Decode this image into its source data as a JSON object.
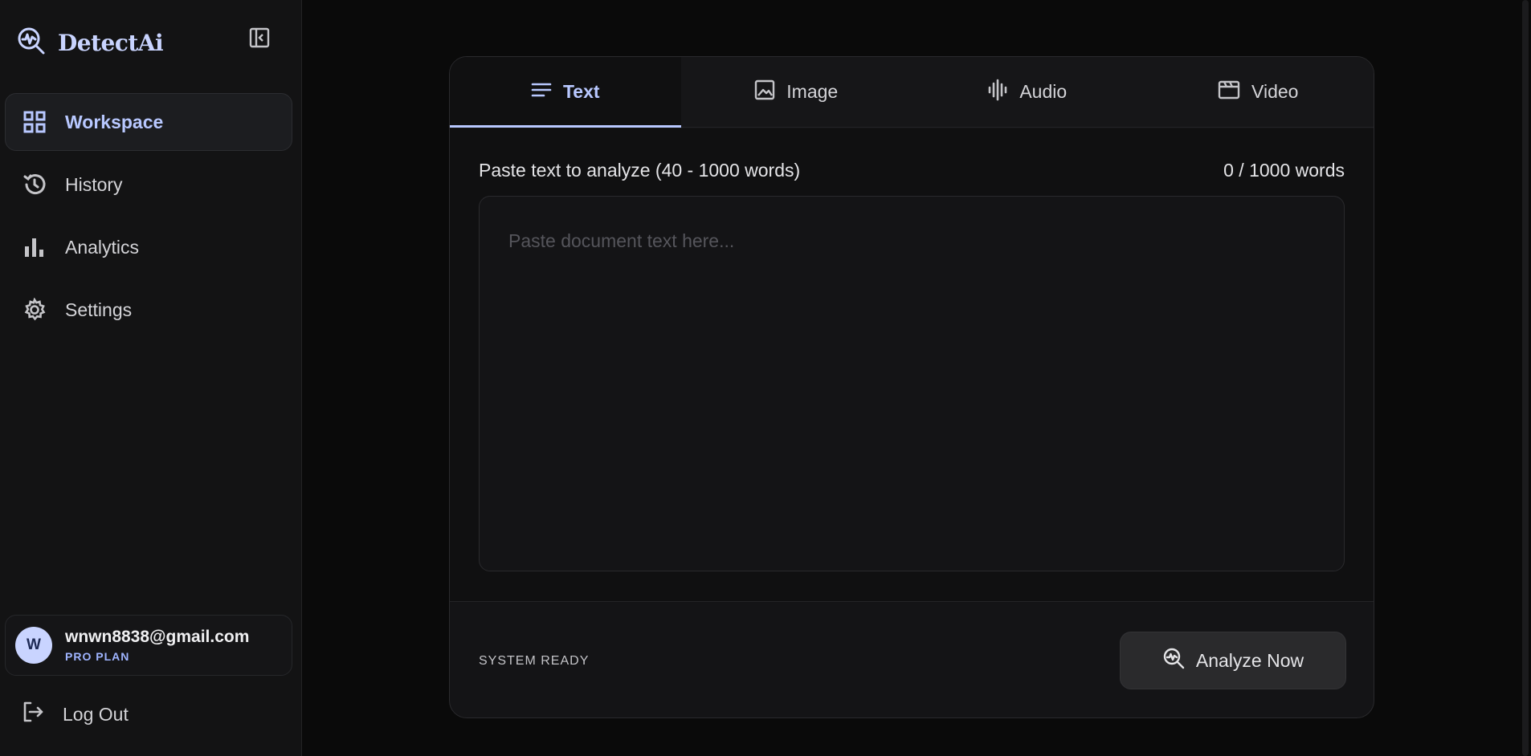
{
  "app": {
    "name": "DetectAi"
  },
  "sidebar": {
    "items": [
      {
        "label": "Workspace",
        "icon": "grid-icon",
        "active": true
      },
      {
        "label": "History",
        "icon": "history-icon",
        "active": false
      },
      {
        "label": "Analytics",
        "icon": "bar-chart-icon",
        "active": false
      },
      {
        "label": "Settings",
        "icon": "gear-icon",
        "active": false
      }
    ],
    "user": {
      "initial": "W",
      "email": "wnwn8838@gmail.com",
      "plan": "PRO PLAN"
    },
    "logout_label": "Log Out"
  },
  "main": {
    "tabs": [
      {
        "label": "Text",
        "icon": "text-lines-icon",
        "active": true
      },
      {
        "label": "Image",
        "icon": "image-icon",
        "active": false
      },
      {
        "label": "Audio",
        "icon": "audio-wave-icon",
        "active": false
      },
      {
        "label": "Video",
        "icon": "clapperboard-icon",
        "active": false
      }
    ],
    "input_label": "Paste text to analyze (40 - 1000 words)",
    "word_count": "0 / 1000 words",
    "textarea": {
      "placeholder": "Paste document text here...",
      "value": ""
    },
    "status": "SYSTEM READY",
    "analyze_label": "Analyze Now"
  },
  "colors": {
    "accent": "#b8c8ff",
    "background": "#0a0a0a",
    "panel": "#141416"
  }
}
